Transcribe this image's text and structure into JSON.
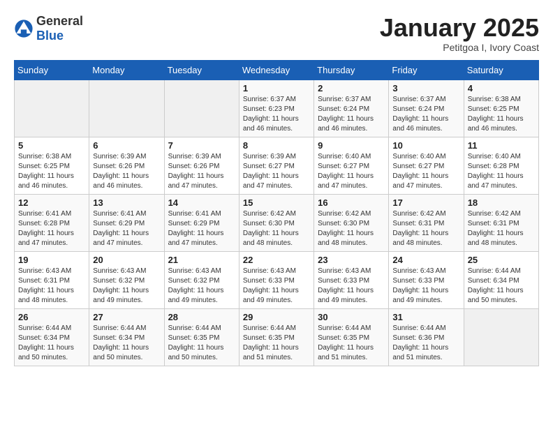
{
  "header": {
    "logo_general": "General",
    "logo_blue": "Blue",
    "title": "January 2025",
    "subtitle": "Petitgoa I, Ivory Coast"
  },
  "days_of_week": [
    "Sunday",
    "Monday",
    "Tuesday",
    "Wednesday",
    "Thursday",
    "Friday",
    "Saturday"
  ],
  "weeks": [
    [
      {
        "day": "",
        "info": ""
      },
      {
        "day": "",
        "info": ""
      },
      {
        "day": "",
        "info": ""
      },
      {
        "day": "1",
        "info": "Sunrise: 6:37 AM\nSunset: 6:23 PM\nDaylight: 11 hours\nand 46 minutes."
      },
      {
        "day": "2",
        "info": "Sunrise: 6:37 AM\nSunset: 6:24 PM\nDaylight: 11 hours\nand 46 minutes."
      },
      {
        "day": "3",
        "info": "Sunrise: 6:37 AM\nSunset: 6:24 PM\nDaylight: 11 hours\nand 46 minutes."
      },
      {
        "day": "4",
        "info": "Sunrise: 6:38 AM\nSunset: 6:25 PM\nDaylight: 11 hours\nand 46 minutes."
      }
    ],
    [
      {
        "day": "5",
        "info": "Sunrise: 6:38 AM\nSunset: 6:25 PM\nDaylight: 11 hours\nand 46 minutes."
      },
      {
        "day": "6",
        "info": "Sunrise: 6:39 AM\nSunset: 6:26 PM\nDaylight: 11 hours\nand 46 minutes."
      },
      {
        "day": "7",
        "info": "Sunrise: 6:39 AM\nSunset: 6:26 PM\nDaylight: 11 hours\nand 47 minutes."
      },
      {
        "day": "8",
        "info": "Sunrise: 6:39 AM\nSunset: 6:27 PM\nDaylight: 11 hours\nand 47 minutes."
      },
      {
        "day": "9",
        "info": "Sunrise: 6:40 AM\nSunset: 6:27 PM\nDaylight: 11 hours\nand 47 minutes."
      },
      {
        "day": "10",
        "info": "Sunrise: 6:40 AM\nSunset: 6:27 PM\nDaylight: 11 hours\nand 47 minutes."
      },
      {
        "day": "11",
        "info": "Sunrise: 6:40 AM\nSunset: 6:28 PM\nDaylight: 11 hours\nand 47 minutes."
      }
    ],
    [
      {
        "day": "12",
        "info": "Sunrise: 6:41 AM\nSunset: 6:28 PM\nDaylight: 11 hours\nand 47 minutes."
      },
      {
        "day": "13",
        "info": "Sunrise: 6:41 AM\nSunset: 6:29 PM\nDaylight: 11 hours\nand 47 minutes."
      },
      {
        "day": "14",
        "info": "Sunrise: 6:41 AM\nSunset: 6:29 PM\nDaylight: 11 hours\nand 47 minutes."
      },
      {
        "day": "15",
        "info": "Sunrise: 6:42 AM\nSunset: 6:30 PM\nDaylight: 11 hours\nand 48 minutes."
      },
      {
        "day": "16",
        "info": "Sunrise: 6:42 AM\nSunset: 6:30 PM\nDaylight: 11 hours\nand 48 minutes."
      },
      {
        "day": "17",
        "info": "Sunrise: 6:42 AM\nSunset: 6:31 PM\nDaylight: 11 hours\nand 48 minutes."
      },
      {
        "day": "18",
        "info": "Sunrise: 6:42 AM\nSunset: 6:31 PM\nDaylight: 11 hours\nand 48 minutes."
      }
    ],
    [
      {
        "day": "19",
        "info": "Sunrise: 6:43 AM\nSunset: 6:31 PM\nDaylight: 11 hours\nand 48 minutes."
      },
      {
        "day": "20",
        "info": "Sunrise: 6:43 AM\nSunset: 6:32 PM\nDaylight: 11 hours\nand 49 minutes."
      },
      {
        "day": "21",
        "info": "Sunrise: 6:43 AM\nSunset: 6:32 PM\nDaylight: 11 hours\nand 49 minutes."
      },
      {
        "day": "22",
        "info": "Sunrise: 6:43 AM\nSunset: 6:33 PM\nDaylight: 11 hours\nand 49 minutes."
      },
      {
        "day": "23",
        "info": "Sunrise: 6:43 AM\nSunset: 6:33 PM\nDaylight: 11 hours\nand 49 minutes."
      },
      {
        "day": "24",
        "info": "Sunrise: 6:43 AM\nSunset: 6:33 PM\nDaylight: 11 hours\nand 49 minutes."
      },
      {
        "day": "25",
        "info": "Sunrise: 6:44 AM\nSunset: 6:34 PM\nDaylight: 11 hours\nand 50 minutes."
      }
    ],
    [
      {
        "day": "26",
        "info": "Sunrise: 6:44 AM\nSunset: 6:34 PM\nDaylight: 11 hours\nand 50 minutes."
      },
      {
        "day": "27",
        "info": "Sunrise: 6:44 AM\nSunset: 6:34 PM\nDaylight: 11 hours\nand 50 minutes."
      },
      {
        "day": "28",
        "info": "Sunrise: 6:44 AM\nSunset: 6:35 PM\nDaylight: 11 hours\nand 50 minutes."
      },
      {
        "day": "29",
        "info": "Sunrise: 6:44 AM\nSunset: 6:35 PM\nDaylight: 11 hours\nand 51 minutes."
      },
      {
        "day": "30",
        "info": "Sunrise: 6:44 AM\nSunset: 6:35 PM\nDaylight: 11 hours\nand 51 minutes."
      },
      {
        "day": "31",
        "info": "Sunrise: 6:44 AM\nSunset: 6:36 PM\nDaylight: 11 hours\nand 51 minutes."
      },
      {
        "day": "",
        "info": ""
      }
    ]
  ]
}
